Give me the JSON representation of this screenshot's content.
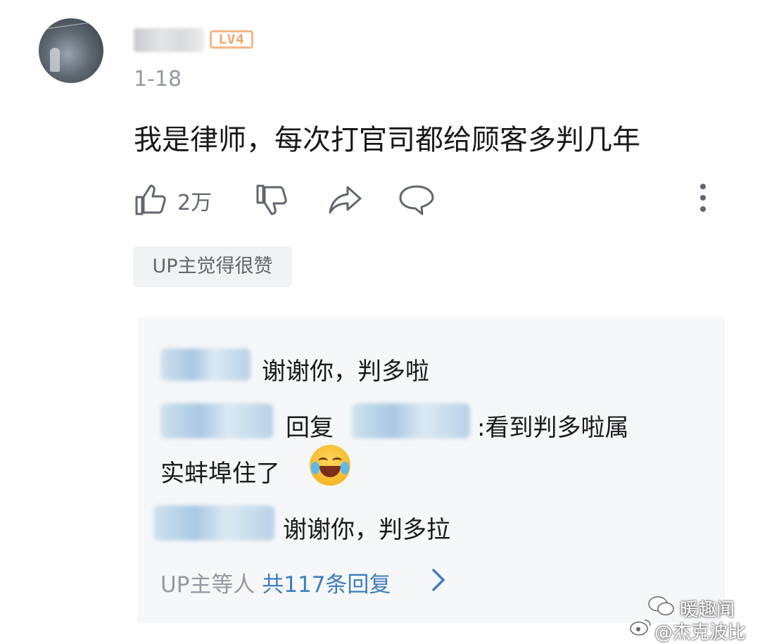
{
  "comment": {
    "level_badge": "LV4",
    "date": "1-18",
    "text": "我是律师，每次打官司都给顾客多判几年",
    "like_count": "2万",
    "up_tag": "UP主觉得很赞"
  },
  "replies": [
    {
      "text": "谢谢你，判多啦"
    },
    {
      "reply_word": "回复",
      "text_line1": ":看到判多啦属",
      "text_line2": "实蚌埠住了"
    },
    {
      "text": "谢谢你，判多拉"
    }
  ],
  "more_replies": {
    "prefix": "UP主等人",
    "count_label": "共117条回复"
  },
  "watermark": {
    "line1": "暖趣闻",
    "line2": "@杰克波比"
  },
  "icons": [
    "avatar",
    "like-icon",
    "dislike-icon",
    "share-icon",
    "comment-icon",
    "more-icon",
    "chevron-right-icon",
    "laughing-emoji",
    "wechat-icon",
    "weibo-icon"
  ],
  "colors": {
    "accent": "#3e7ebf",
    "muted": "#9499a0",
    "badge": "#f4a667",
    "reply_bg": "#f6f7f8"
  }
}
